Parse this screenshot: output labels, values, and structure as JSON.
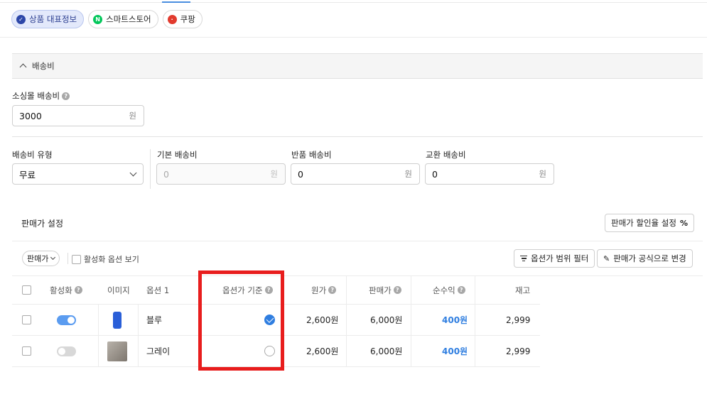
{
  "tabs": [
    {
      "label": "상품 대표정보",
      "active": true,
      "icon": "check-circle-icon"
    },
    {
      "label": "스마트스토어",
      "active": false,
      "icon": "naver-icon"
    },
    {
      "label": "쿠팡",
      "active": false,
      "icon": "coupang-icon"
    }
  ],
  "shipping": {
    "section_title": "배송비",
    "sourcing_label": "소싱몰 배송비",
    "sourcing_value": "3000",
    "unit": "원",
    "type_label": "배송비 유형",
    "type_value": "무료",
    "base_label": "기본 배송비",
    "base_placeholder": "0",
    "return_label": "반품 배송비",
    "return_value": "0",
    "exchange_label": "교환 배송비",
    "exchange_value": "0"
  },
  "pricing": {
    "title": "판매가 설정",
    "discount_button": "판매가 할인율 설정",
    "discount_icon": "%",
    "mode_select": "판매가",
    "show_inactive_label": "활성화 옵션 보기",
    "filter_button": "옵션가 범위 필터",
    "formula_button": "판매가 공식으로 변경"
  },
  "table": {
    "headers": {
      "active": "활성화",
      "image": "이미지",
      "option1": "옵션 1",
      "base_price": "옵션가 기준",
      "cost": "원가",
      "price": "판매가",
      "profit": "순수익",
      "stock": "재고"
    },
    "rows": [
      {
        "active": true,
        "option": "블루",
        "base": true,
        "cost": "2,600원",
        "price": "6,000원",
        "profit": "400원",
        "stock": "2,999"
      },
      {
        "active": false,
        "option": "그레이",
        "base": false,
        "cost": "2,600원",
        "price": "6,000원",
        "profit": "400원",
        "stock": "2,999"
      }
    ]
  },
  "colors": {
    "accent": "#2f7ee0",
    "highlight": "#e81d1d",
    "active_chip": "#e3e9fb"
  }
}
